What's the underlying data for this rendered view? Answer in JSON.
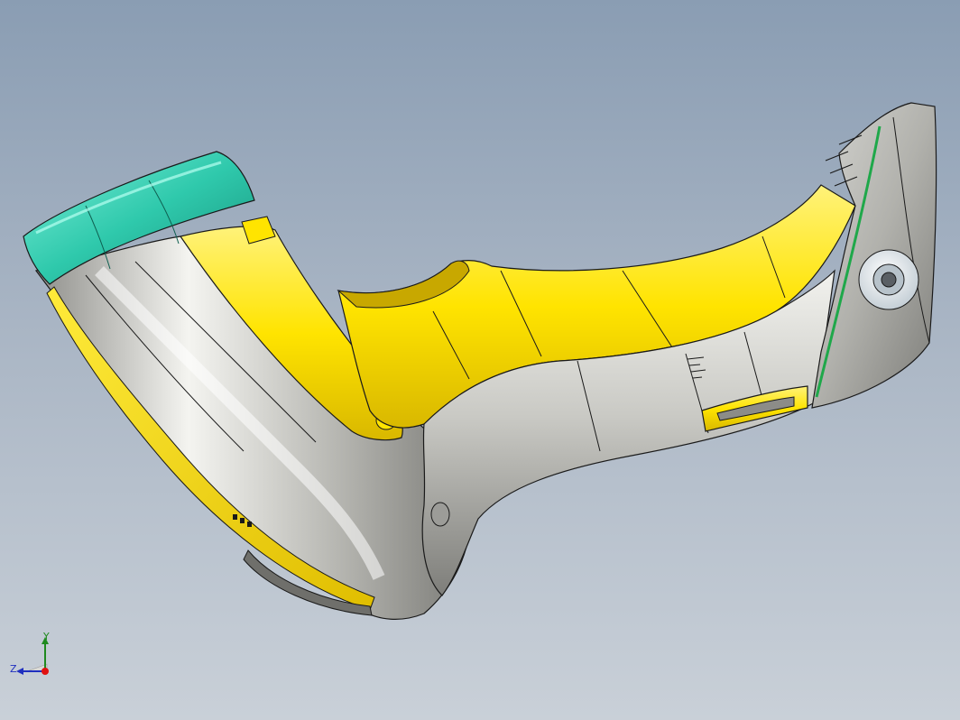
{
  "viewport": {
    "background_top": "#8a9db3",
    "background_bottom": "#c9d0d8"
  },
  "model": {
    "type": "handheld-barcode-scanner",
    "colors": {
      "housing": "#c8c8c4",
      "housing_dark": "#8e8e8a",
      "accent": "#ffe400",
      "accent_dark": "#d9b800",
      "bumper": "#2fc9ac",
      "lens_window": "#e8ecef",
      "edge": "#1a1a1a"
    }
  },
  "triad": {
    "y_label": "Y",
    "z_label": "Z",
    "y_color": "#1f8a1f",
    "z_color": "#1f2fbf",
    "x_color": "#e01010"
  }
}
